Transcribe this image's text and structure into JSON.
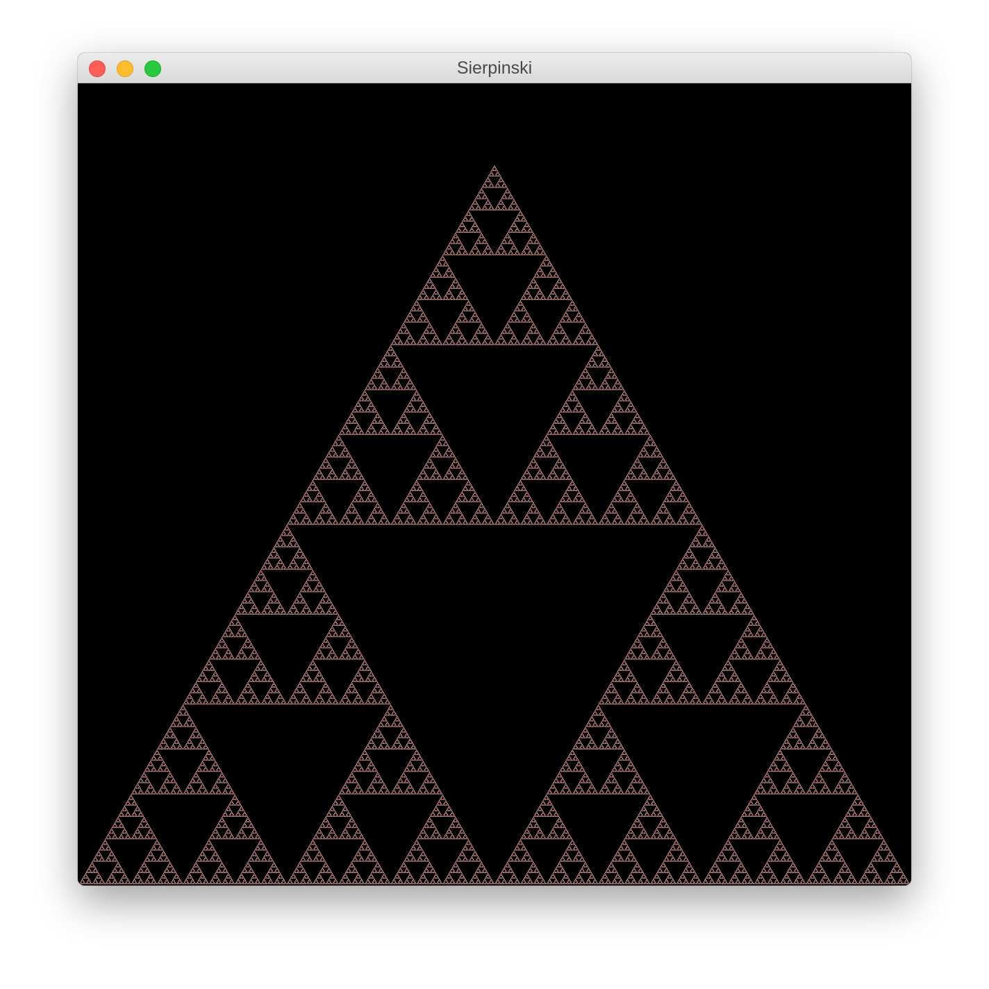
{
  "window": {
    "title": "Sierpinski",
    "controls": {
      "close_color": "#ff5f57",
      "minimize_color": "#febc2e",
      "zoom_color": "#28c840"
    }
  },
  "canvas": {
    "background_color": "#000000",
    "fractal_color": "#ffb1b1",
    "fractal": "sierpinski-triangle"
  }
}
